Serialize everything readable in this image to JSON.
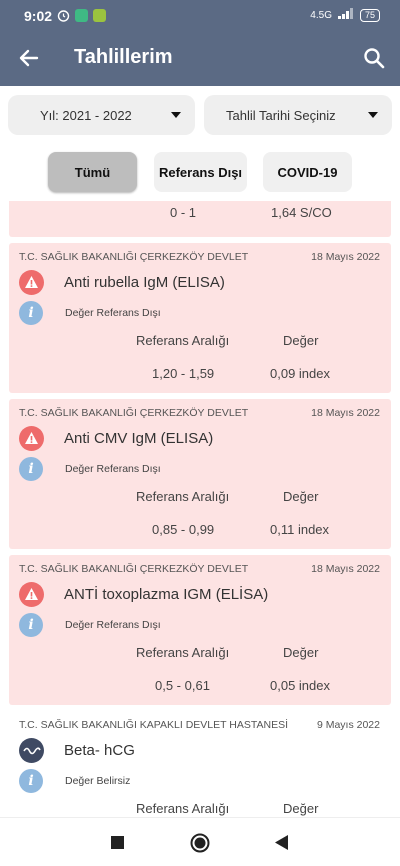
{
  "status_bar": {
    "time": "9:02",
    "network": "4.5G",
    "battery": "75"
  },
  "app_bar": {
    "title": "Tahlillerim"
  },
  "filters": {
    "year": "Yıl: 2021 - 2022",
    "date": "Tahlil Tarihi Seçiniz"
  },
  "tabs": [
    "Tümü",
    "Referans Dışı",
    "COVID-19"
  ],
  "labels": {
    "reference": "Referans Aralığı",
    "value": "Değer"
  },
  "partial_card": {
    "range": "0 - 1",
    "value": "1,64 S/CO"
  },
  "cards": [
    {
      "hospital": "T.C. SAĞLIK BAKANLIĞI ÇERKEZKÖY DEVLET",
      "date": "18 Mayıs 2022",
      "name": "Anti rubella IgM (ELISA)",
      "status": "Değer Referans Dışı",
      "range": "1,20 - 1,59",
      "value": "0,09 index"
    },
    {
      "hospital": "T.C. SAĞLIK BAKANLIĞI ÇERKEZKÖY DEVLET",
      "date": "18 Mayıs 2022",
      "name": "Anti CMV IgM (ELISA)",
      "status": "Değer Referans Dışı",
      "range": "0,85 - 0,99",
      "value": "0,11 index"
    },
    {
      "hospital": "T.C. SAĞLIK BAKANLIĞI ÇERKEZKÖY DEVLET",
      "date": "18 Mayıs 2022",
      "name": "ANTİ toxoplazma IGM (ELİSA)",
      "status": "Değer Referans Dışı",
      "range": "0,5 - 0,61",
      "value": "0,05 index"
    }
  ],
  "last_card": {
    "hospital": "T.C. SAĞLIK BAKANLIĞI KAPAKLI DEVLET HASTANESİ",
    "date": "9 Mayıs 2022",
    "name": "Beta- hCG",
    "status": "Değer Belirsiz"
  }
}
